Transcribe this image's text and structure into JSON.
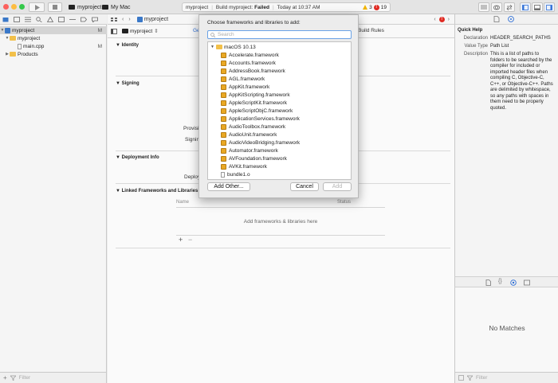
{
  "toolbar": {
    "scheme_name": "myproject",
    "destination": "My Mac",
    "activity": {
      "project": "myproject",
      "build_status_prefix": "Build myproject:",
      "build_status": "Failed",
      "time": "Today at 10:37 AM",
      "warning_count": "3",
      "error_count": "19"
    }
  },
  "navigator": {
    "items": [
      {
        "label": "myproject",
        "badge": "M"
      },
      {
        "label": "myproject",
        "badge": ""
      },
      {
        "label": "main.cpp",
        "badge": "M"
      },
      {
        "label": "Products",
        "badge": ""
      }
    ],
    "filter_placeholder": "Filter"
  },
  "editor": {
    "jump_project": "myproject",
    "target": "myproject",
    "tab_general": "Ge",
    "tab_build_rules": "Build Rules",
    "sections": {
      "identity": "Identity",
      "signing": "Signing",
      "deployment": "Deployment Info",
      "linked": "Linked Frameworks and Libraries"
    },
    "fragments": {
      "provisioning": "Provisi",
      "signing": "Signing",
      "deployment": "Deploy"
    },
    "table": {
      "col_name": "Name",
      "col_status": "Status",
      "empty": "Add frameworks & libraries here"
    },
    "add": "+",
    "remove": "−"
  },
  "sheet": {
    "title": "Choose frameworks and libraries to add:",
    "search_placeholder": "Search",
    "group": "macOS 10.13",
    "frameworks": [
      "Accelerate.framework",
      "Accounts.framework",
      "AddressBook.framework",
      "AGL.framework",
      "AppKit.framework",
      "AppKitScripting.framework",
      "AppleScriptKit.framework",
      "AppleScriptObjC.framework",
      "ApplicationServices.framework",
      "AudioToolbox.framework",
      "AudioUnit.framework",
      "AudioVideoBridging.framework",
      "Automator.framework",
      "AVFoundation.framework",
      "AVKit.framework"
    ],
    "extra_item": "bundle1.o",
    "add_other": "Add Other...",
    "cancel": "Cancel",
    "add": "Add"
  },
  "inspector": {
    "title": "Quick Help",
    "declaration_label": "Declaration",
    "declaration": "HEADER_SEARCH_PATHS",
    "value_type_label": "Value Type",
    "value_type": "Path List",
    "description_label": "Description",
    "description": "This is a list of paths to folders to be searched by the compiler for included or imported header files when compiling C, Objective-C, C++, or Objective-C++. Paths are delimited by whitespace, so any paths with spaces in them need to be properly quoted."
  },
  "library": {
    "empty": "No Matches",
    "filter_placeholder": "Filter"
  },
  "colors": {
    "accent": "#3a78c8",
    "error": "#e02a22",
    "warning": "#f0b400",
    "failed_text": "#111111"
  }
}
